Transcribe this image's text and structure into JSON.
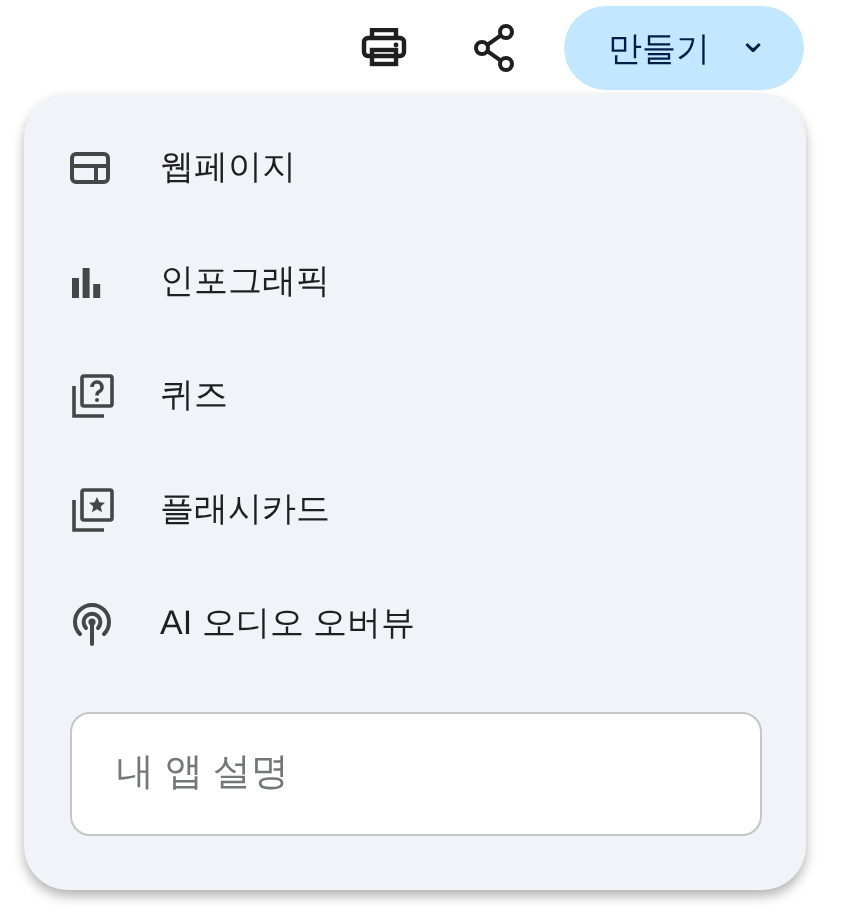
{
  "toolbar": {
    "create_button": {
      "label": "만들기",
      "caret": "⌄",
      "expanded": true
    }
  },
  "menu": {
    "items": [
      {
        "kind": "webpage",
        "label": "웹페이지"
      },
      {
        "kind": "infographic",
        "label": "인포그래픽"
      },
      {
        "kind": "quiz",
        "label": "퀴즈"
      },
      {
        "kind": "flashcard",
        "label": "플래시카드"
      },
      {
        "kind": "audio",
        "label": "AI 오디오 오버뷰"
      }
    ],
    "input": {
      "placeholder": "내 앱 설명"
    }
  }
}
